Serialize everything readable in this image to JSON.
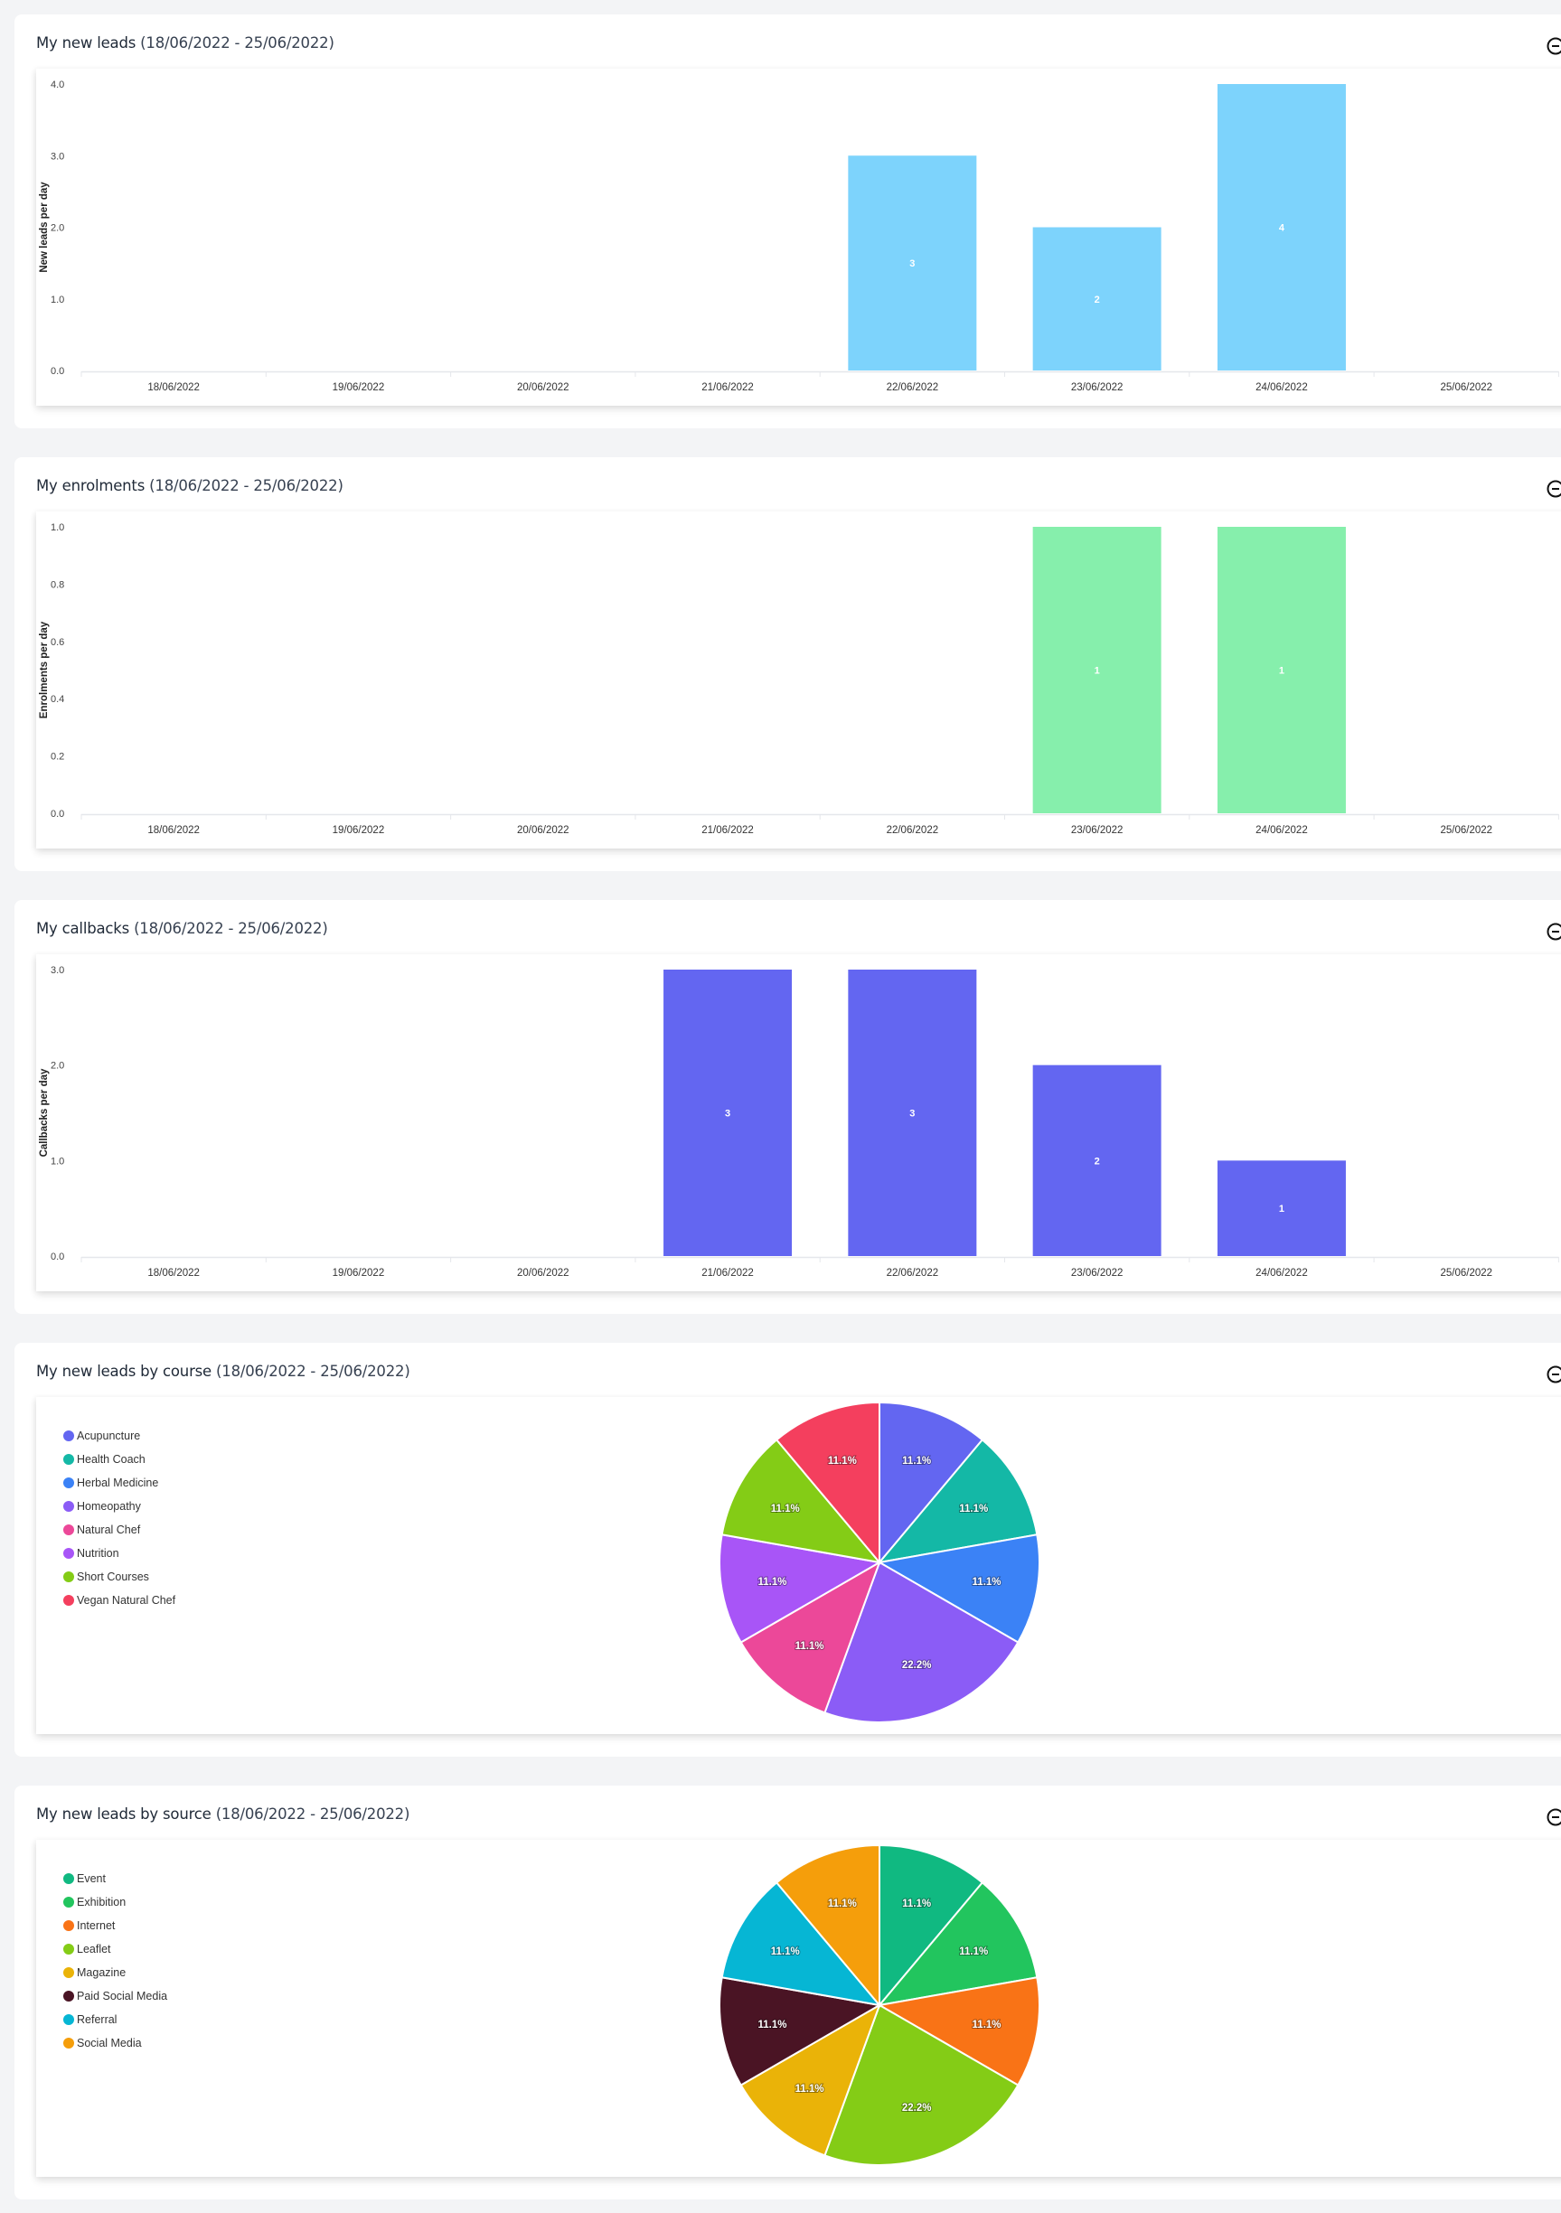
{
  "collapse_icon": "minus-circle-icon",
  "cards": [
    {
      "title": "My new leads",
      "range": "(18/06/2022 - 25/06/2022)"
    },
    {
      "title": "My enrolments",
      "range": "(18/06/2022 - 25/06/2022)"
    },
    {
      "title": "My callbacks",
      "range": "(18/06/2022 - 25/06/2022)"
    },
    {
      "title": "My new leads by course",
      "range": "(18/06/2022 - 25/06/2022)"
    },
    {
      "title": "My new leads by source",
      "range": "(18/06/2022 - 25/06/2022)"
    }
  ],
  "chart_data": [
    {
      "type": "bar",
      "title": "My new leads (18/06/2022 - 25/06/2022)",
      "categories": [
        "18/06/2022",
        "19/06/2022",
        "20/06/2022",
        "21/06/2022",
        "22/06/2022",
        "23/06/2022",
        "24/06/2022",
        "25/06/2022"
      ],
      "values": [
        0,
        0,
        0,
        0,
        3,
        2,
        4,
        0
      ],
      "xlabel": "",
      "ylabel": "New leads per day",
      "ylim": [
        0,
        4
      ],
      "yticks": [
        "0.0",
        "1.0",
        "2.0",
        "3.0",
        "4.0"
      ],
      "color": "#7dd3fc",
      "grid": false,
      "data_labels": true
    },
    {
      "type": "bar",
      "title": "My enrolments (18/06/2022 - 25/06/2022)",
      "categories": [
        "18/06/2022",
        "19/06/2022",
        "20/06/2022",
        "21/06/2022",
        "22/06/2022",
        "23/06/2022",
        "24/06/2022",
        "25/06/2022"
      ],
      "values": [
        0,
        0,
        0,
        0,
        0,
        1,
        1,
        0
      ],
      "xlabel": "",
      "ylabel": "Enrolments per day",
      "ylim": [
        0,
        1
      ],
      "yticks": [
        "0.0",
        "0.2",
        "0.4",
        "0.6",
        "0.8",
        "1.0"
      ],
      "color": "#86efac",
      "grid": false,
      "data_labels": true
    },
    {
      "type": "bar",
      "title": "My callbacks (18/06/2022 - 25/06/2022)",
      "categories": [
        "18/06/2022",
        "19/06/2022",
        "20/06/2022",
        "21/06/2022",
        "22/06/2022",
        "23/06/2022",
        "24/06/2022",
        "25/06/2022"
      ],
      "values": [
        0,
        0,
        0,
        3,
        3,
        2,
        1,
        0
      ],
      "xlabel": "",
      "ylabel": "Callbacks per day",
      "ylim": [
        0,
        3
      ],
      "yticks": [
        "0.0",
        "1.0",
        "2.0",
        "3.0"
      ],
      "color": "#6366f1",
      "grid": false,
      "data_labels": true
    },
    {
      "type": "pie",
      "title": "My new leads by course (18/06/2022 - 25/06/2022)",
      "legend_position": "top-left",
      "slices": [
        {
          "label": "Acupuncture",
          "value": 11.1,
          "display": "11.1%",
          "color": "#6366f1"
        },
        {
          "label": "Health Coach",
          "value": 11.1,
          "display": "11.1%",
          "color": "#14b8a6"
        },
        {
          "label": "Herbal Medicine",
          "value": 11.1,
          "display": "11.1%",
          "color": "#3b82f6"
        },
        {
          "label": "Homeopathy",
          "value": 22.2,
          "display": "22.2%",
          "color": "#8b5cf6"
        },
        {
          "label": "Natural Chef",
          "value": 11.1,
          "display": "11.1%",
          "color": "#ec4899"
        },
        {
          "label": "Nutrition",
          "value": 11.1,
          "display": "11.1%",
          "color": "#a855f7"
        },
        {
          "label": "Short Courses",
          "value": 11.1,
          "display": "11.1%",
          "color": "#84cc16"
        },
        {
          "label": "Vegan Natural Chef",
          "value": 11.1,
          "display": "11.1%",
          "color": "#f43f5e"
        }
      ]
    },
    {
      "type": "pie",
      "title": "My new leads by source (18/06/2022 - 25/06/2022)",
      "legend_position": "top-left",
      "slices": [
        {
          "label": "Event",
          "value": 11.1,
          "display": "11.1%",
          "color": "#10b981"
        },
        {
          "label": "Exhibition",
          "value": 11.1,
          "display": "11.1%",
          "color": "#22c55e"
        },
        {
          "label": "Internet",
          "value": 11.1,
          "display": "11.1%",
          "color": "#f97316"
        },
        {
          "label": "Leaflet",
          "value": 22.2,
          "display": "22.2%",
          "color": "#84cc16"
        },
        {
          "label": "Magazine",
          "value": 11.1,
          "display": "11.1%",
          "color": "#eab308"
        },
        {
          "label": "Paid Social Media",
          "value": 11.1,
          "display": "11.1%",
          "color": "#4a1424"
        },
        {
          "label": "Referral",
          "value": 11.1,
          "display": "11.1%",
          "color": "#06b6d4"
        },
        {
          "label": "Social Media",
          "value": 11.1,
          "display": "11.1%",
          "color": "#f59e0b"
        }
      ]
    }
  ]
}
